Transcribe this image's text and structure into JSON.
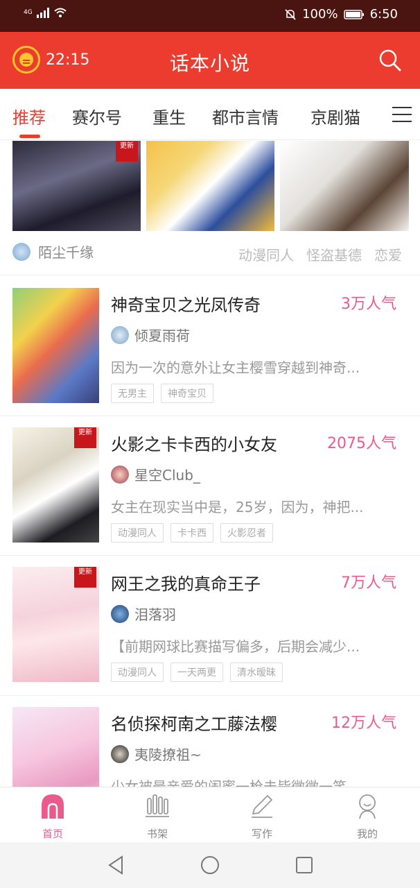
{
  "status_bar": {
    "network": "4G",
    "battery": "100%",
    "time": "6:50"
  },
  "header": {
    "clock": "22:15",
    "title": "话本小说"
  },
  "tabs": [
    {
      "label": "推荐",
      "active": true
    },
    {
      "label": "赛尔号"
    },
    {
      "label": "重生"
    },
    {
      "label": "都市言情"
    },
    {
      "label": "京剧猫"
    }
  ],
  "featured": {
    "update_label": "更新",
    "author": "陌尘千缘",
    "tags": [
      "动漫同人",
      "怪盗基德",
      "恋爱"
    ]
  },
  "books": [
    {
      "title": "神奇宝贝之光凤传奇",
      "popularity": "3万人气",
      "author": "倾夏雨荷",
      "description": "因为一次的意外让女主樱雪穿越到神奇...",
      "tags": [
        "无男主",
        "神奇宝贝"
      ],
      "updated": false
    },
    {
      "title": "火影之卡卡西的小女友",
      "popularity": "2075人气",
      "author": "星空Club_",
      "description": "女主在现实当中是，25岁，因为，神把...",
      "tags": [
        "动漫同人",
        "卡卡西",
        "火影忍者"
      ],
      "updated": true
    },
    {
      "title": "网王之我的真命王子",
      "popularity": "7万人气",
      "author": "泪落羽",
      "description": "【前期网球比赛描写偏多，后期会减少...",
      "tags": [
        "动漫同人",
        "一天两更",
        "清水暧昧"
      ],
      "updated": true
    },
    {
      "title": "名侦探柯南之工藤法樱",
      "popularity": "12万人气",
      "author": "夷陵撩祖~",
      "description": "少女被最亲爱的闺蜜一枪击毙微微一笑...",
      "tags": [],
      "updated": false
    }
  ],
  "bottom_nav": [
    {
      "label": "首页",
      "icon": "home-icon",
      "active": true
    },
    {
      "label": "书架",
      "icon": "bookshelf-icon"
    },
    {
      "label": "写作",
      "icon": "pen-icon"
    },
    {
      "label": "我的",
      "icon": "profile-icon"
    }
  ],
  "colors": {
    "brand_red": "#ec3b2f",
    "pink": "#ec5a8b",
    "status_bar": "#4a1410"
  }
}
